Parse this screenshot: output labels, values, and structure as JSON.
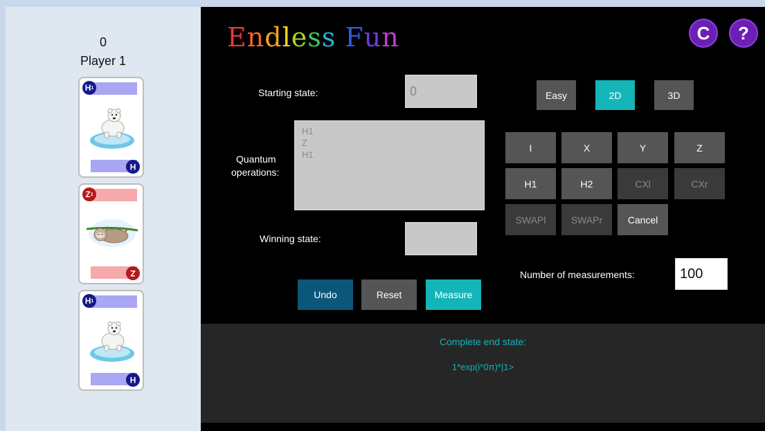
{
  "player": {
    "score": "0",
    "name": "Player 1"
  },
  "cards": [
    {
      "gate": "H",
      "sub": "1",
      "color": "blue",
      "art": "polar-bear"
    },
    {
      "gate": "Z",
      "sub": "1",
      "color": "red",
      "art": "sloth"
    },
    {
      "gate": "H",
      "sub": "1",
      "color": "blue",
      "art": "polar-bear"
    }
  ],
  "header": {
    "title_letters": [
      "E",
      "n",
      "d",
      "l",
      "e",
      "s",
      "s",
      " ",
      "F",
      "u",
      "n"
    ],
    "title_colors": [
      "#e53935",
      "#f1662a",
      "#f7a21b",
      "#f7d31b",
      "#a8d81e",
      "#3cc85a",
      "#1fb4d8",
      "#000000",
      "#2d5be3",
      "#6b3be0",
      "#c23bd4"
    ],
    "btn_c": "C",
    "btn_help": "?"
  },
  "form": {
    "starting_state_label": "Starting state:",
    "starting_state_value": "0",
    "ops_label_line1": "Quantum",
    "ops_label_line2": "operations:",
    "operations": [
      "H1",
      "Z",
      "H1"
    ],
    "winning_state_label": "Winning state:",
    "winning_state_value": "",
    "measurements_label": "Number of measurements:",
    "measurements_value": "100"
  },
  "modes": [
    {
      "label": "Easy",
      "state": "normal"
    },
    {
      "label": "2D",
      "state": "selected"
    },
    {
      "label": "3D",
      "state": "normal"
    }
  ],
  "gates": [
    {
      "label": "I",
      "state": "enabled"
    },
    {
      "label": "X",
      "state": "enabled"
    },
    {
      "label": "Y",
      "state": "enabled"
    },
    {
      "label": "Z",
      "state": "enabled"
    },
    {
      "label": "H1",
      "state": "enabled"
    },
    {
      "label": "H2",
      "state": "enabled"
    },
    {
      "label": "CXl",
      "state": "disabled"
    },
    {
      "label": "CXr",
      "state": "disabled"
    },
    {
      "label": "SWAPl",
      "state": "disabled"
    },
    {
      "label": "SWAPr",
      "state": "disabled"
    },
    {
      "label": "Cancel",
      "state": "enabled"
    }
  ],
  "actions": {
    "undo": "Undo",
    "reset": "Reset",
    "measure": "Measure"
  },
  "result": {
    "label": "Complete end state:",
    "value": "1*exp(i*0π)*|1>"
  },
  "colors": {
    "accent": "#14b5b8",
    "undo": "#0b577a",
    "help_purple": "#6b1fb5",
    "card_blue": "#a9a6f3",
    "card_red": "#f6a9ab"
  }
}
